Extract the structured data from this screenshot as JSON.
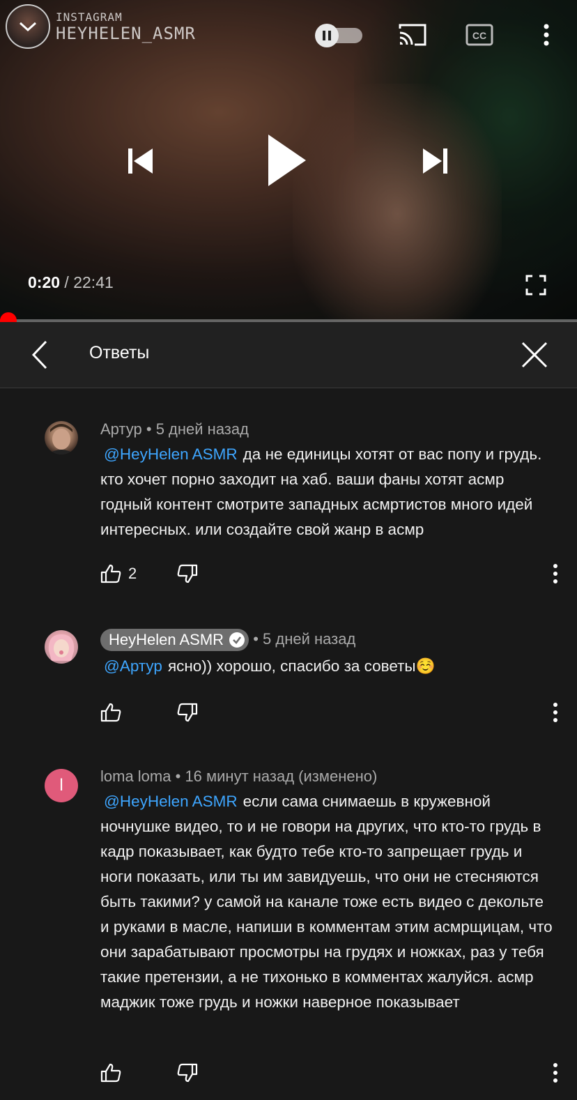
{
  "watermark": {
    "line1": "INSTAGRAM",
    "line2": "HEYHELEN_ASMR"
  },
  "player": {
    "current_time": "0:20",
    "separator": " / ",
    "duration": "22:41",
    "progress_fraction": 0.0147,
    "autoplay": "on",
    "state": "paused"
  },
  "replies_panel": {
    "title": "Ответы"
  },
  "comments": [
    {
      "author": "Артур",
      "time": "5 дней назад",
      "mention": "@HeyHelen ASMR",
      "text": "да не единицы хотят от вас попу и грудь. кто хочет порно заходит на хаб. ваши фаны хотят асмр годный контент смотрите западных асмртистов много идей интересных. или создайте свой жанр в асмр",
      "likes": "2"
    },
    {
      "author": "HeyHelen ASMR",
      "time": "5 дней назад",
      "mention": "@Артур",
      "text": "ясно)) хорошо, спасибо за советы☺️",
      "likes": ""
    },
    {
      "author": "loma loma",
      "avatar_letter": "l",
      "time": "16 минут назад (изменено)",
      "mention": "@HeyHelen ASMR",
      "text": "если сама снимаешь в кружевной ночнушке видео, то и не говори на других, что кто-то грудь в кадр показывает, как будто тебе кто-то запрещает грудь и ноги показать, или ты им завидуешь, что они не стесняются быть такими? у самой на канале тоже есть видео с декольте и руками в масле, напиши в комментам этим асмрщицам, что они зарабатывают просмотры на грудях и ножках, раз у тебя такие претензии, а не тихонько в комментах жалуйся. асмр маджик тоже грудь и ножки наверное показывает",
      "likes": ""
    }
  ],
  "dot_separator": "•",
  "colors": {
    "background": "#181818",
    "header": "#212121",
    "mention": "#3ea6ff",
    "progress": "#ff0000",
    "avatar_loma": "#e05a7a"
  }
}
